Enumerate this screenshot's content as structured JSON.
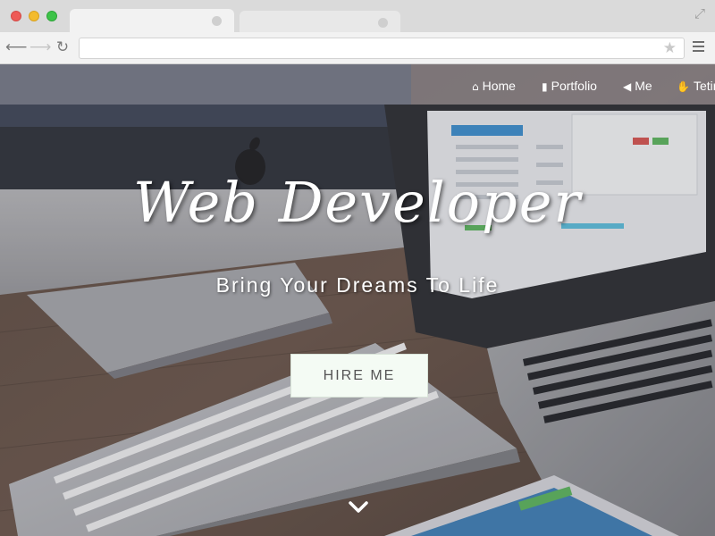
{
  "browser": {
    "icons": {
      "back": "arrow-left-icon",
      "forward": "arrow-right-icon",
      "reload": "reload-icon",
      "bookmark": "star-icon",
      "menu": "hamburger-menu-icon",
      "fullscreen": "expand-icon"
    },
    "address_value": ""
  },
  "navbar": {
    "items": [
      {
        "label": "Home",
        "icon": "home-icon"
      },
      {
        "label": "Portfolio",
        "icon": "bookmark-icon"
      },
      {
        "label": "Me",
        "icon": "megaphone-icon"
      },
      {
        "label": "Tetirs",
        "icon": "thumbs-up-icon"
      }
    ]
  },
  "hero": {
    "title": "Web Developer",
    "subtitle": "Bring Your Dreams To Life",
    "button_label": "HIRE ME",
    "scroll_icon": "chevron-down-icon"
  },
  "colors": {
    "navbar_bg": "#9696a0",
    "button_bg": "#f4fbf4",
    "text": "#ffffff"
  }
}
